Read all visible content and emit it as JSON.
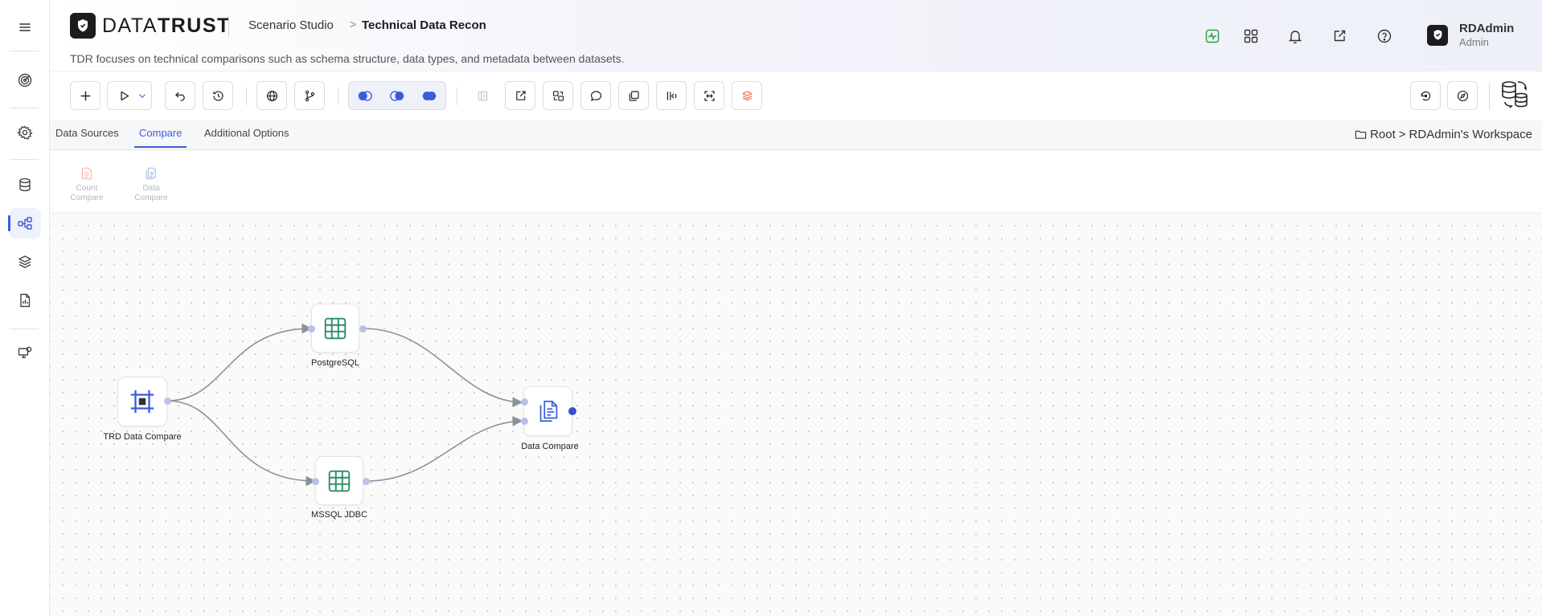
{
  "app": {
    "brand_regular": "DATA",
    "brand_bold": "TRUST",
    "breadcrumb_parent": "Scenario Studio",
    "breadcrumb_separator": ">",
    "breadcrumb_current": "Technical Data Recon",
    "description": "TDR focuses on technical comparisons such as schema structure, data types, and metadata between datasets."
  },
  "user": {
    "name": "RDAdmin",
    "role": "Admin"
  },
  "tabs": [
    {
      "label": "Data Sources",
      "active": false
    },
    {
      "label": "Compare",
      "active": true
    },
    {
      "label": "Additional Options",
      "active": false
    }
  ],
  "workspace": {
    "root": "Root",
    "separator": ">",
    "name": "RDAdmin's Workspace"
  },
  "palette": [
    {
      "line1": "Count",
      "line2": "Compare"
    },
    {
      "line1": "Data",
      "line2": "Compare"
    }
  ],
  "nodes": [
    {
      "label": "TRD Data Compare",
      "icon": "frame-icon"
    },
    {
      "label": "PostgreSQL",
      "icon": "table-icon"
    },
    {
      "label": "MSSQL JDBC",
      "icon": "table-icon"
    },
    {
      "label": "Data Compare",
      "icon": "compare-doc-icon"
    }
  ],
  "colors": {
    "accent": "#3b5bdb",
    "table_green": "#2e8b63",
    "edge": "#8e9096",
    "activity_green": "#2f9e44",
    "layers_orange": "#f07050"
  }
}
